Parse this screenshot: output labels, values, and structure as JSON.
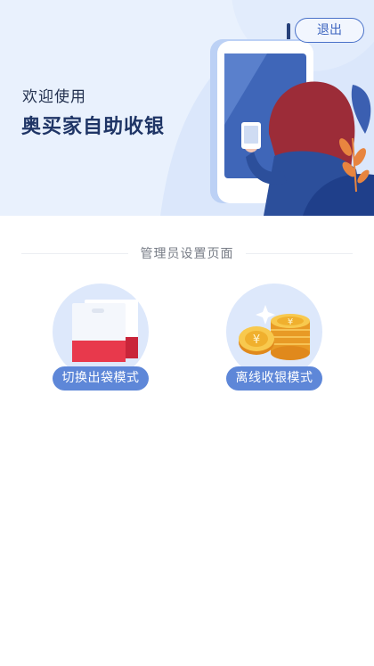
{
  "header": {
    "welcome": "欢迎使用",
    "app_title": "奥买家自助收银",
    "logout_label": "退出"
  },
  "section": {
    "title": "管理员设置页面"
  },
  "modes": [
    {
      "label": "切换出袋模式",
      "icon": "shopping-bag-icon"
    },
    {
      "label": "离线收银模式",
      "icon": "coin-stack-icon"
    }
  ],
  "colors": {
    "hero_bg": "#e9f1fd",
    "accent": "#5e87d8",
    "title": "#1f3566",
    "bag_red": "#e8394c"
  }
}
